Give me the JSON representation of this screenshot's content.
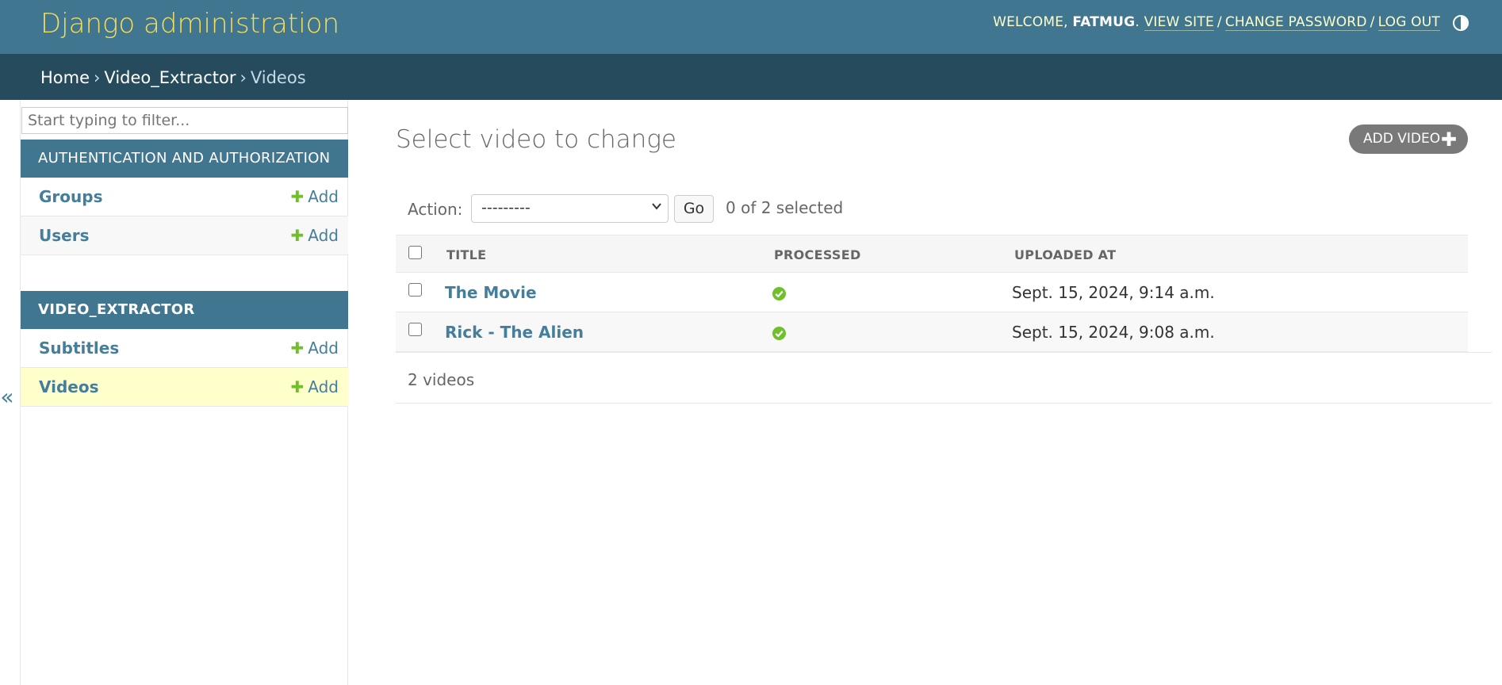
{
  "header": {
    "site_name": "Django administration",
    "welcome": "Welcome,",
    "user": "fatmug",
    "links": [
      "View site",
      "Change password",
      "Log out"
    ]
  },
  "breadcrumbs": {
    "home": "Home",
    "app": "Video_Extractor",
    "current": "Videos",
    "separator": "›"
  },
  "sidebar": {
    "filter_placeholder": "Start typing to filter...",
    "modules": [
      {
        "caption": "Authentication and Authorization",
        "models": [
          {
            "name": "Groups",
            "add": "Add"
          },
          {
            "name": "Users",
            "add": "Add"
          }
        ]
      },
      {
        "caption": "Video_Extractor",
        "models": [
          {
            "name": "Subtitles",
            "add": "Add"
          },
          {
            "name": "Videos",
            "add": "Add"
          }
        ]
      }
    ],
    "toggle": "«"
  },
  "content": {
    "title": "Select video to change",
    "add_button": "Add video",
    "action_label": "Action:",
    "action_selected": "---------",
    "go_label": "Go",
    "selected_count": "0 of 2 selected",
    "columns": [
      "Title",
      "Processed",
      "Uploaded at"
    ],
    "rows": [
      {
        "title": "The Movie",
        "processed": true,
        "uploaded_at": "Sept. 15, 2024, 9:14 a.m."
      },
      {
        "title": "Rick - The Alien",
        "processed": true,
        "uploaded_at": "Sept. 15, 2024, 9:08 a.m."
      }
    ],
    "paginator": "2 videos"
  },
  "colors": {
    "header_bg": "#417690",
    "breadcrumb_bg": "#264b5d",
    "brand_yellow": "#f5dd5d",
    "link_blue": "#447e9b",
    "add_green": "#70bf2b",
    "current_row": "#ffffcc"
  }
}
